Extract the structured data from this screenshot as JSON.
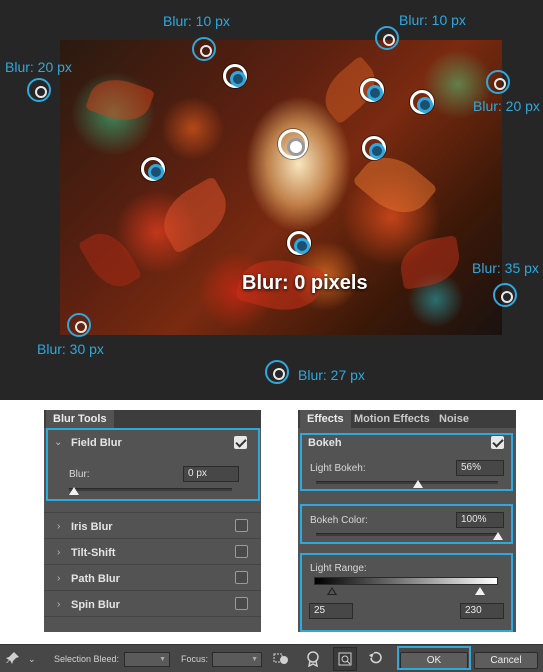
{
  "callouts": {
    "top_left_blur": "Blur: 10 px",
    "top_right_blur": "Blur: 10 px",
    "left_blur": "Blur: 20 px",
    "right_blur": "Blur: 20 px",
    "right_lower_blur": "Blur: 35 px",
    "bottom_left_blur": "Blur: 30 px",
    "bottom_center_blur": "Blur: 27 px",
    "center_label": "Blur: 0 pixels"
  },
  "blur_tools": {
    "tab": "Blur Tools",
    "field_blur": {
      "title": "Field Blur",
      "checked": true,
      "blur_label": "Blur:",
      "blur_value": "0 px",
      "slider_fraction": 0.0
    },
    "items": [
      {
        "label": "Iris Blur",
        "checked": false
      },
      {
        "label": "Tilt-Shift",
        "checked": false
      },
      {
        "label": "Path Blur",
        "checked": false
      },
      {
        "label": "Spin Blur",
        "checked": false
      }
    ]
  },
  "effects": {
    "tabs": [
      "Effects",
      "Motion Effects",
      "Noise"
    ],
    "active_tab": "Effects",
    "bokeh": {
      "title": "Bokeh",
      "checked": true
    },
    "light_bokeh": {
      "label": "Light Bokeh:",
      "value": "56%",
      "fraction": 0.56
    },
    "bokeh_color": {
      "label": "Bokeh Color:",
      "value": "100%",
      "fraction": 1.0
    },
    "light_range": {
      "label": "Light Range:",
      "low": "25",
      "high": "230",
      "low_level": 25,
      "high_level": 230
    }
  },
  "toolbar": {
    "selection_bleed_label": "Selection Bleed:",
    "focus_label": "Focus:",
    "ok_label": "OK",
    "cancel_label": "Cancel"
  },
  "colors": {
    "accent": "#2fa8de",
    "panel": "#535353",
    "stage": "#262626"
  },
  "icons": [
    "pin-icon",
    "checkmark-icon",
    "chevron-right-icon",
    "chevron-down-icon",
    "save-selection-icon",
    "high-quality-icon",
    "preview-toggle-icon",
    "reset-icon"
  ]
}
